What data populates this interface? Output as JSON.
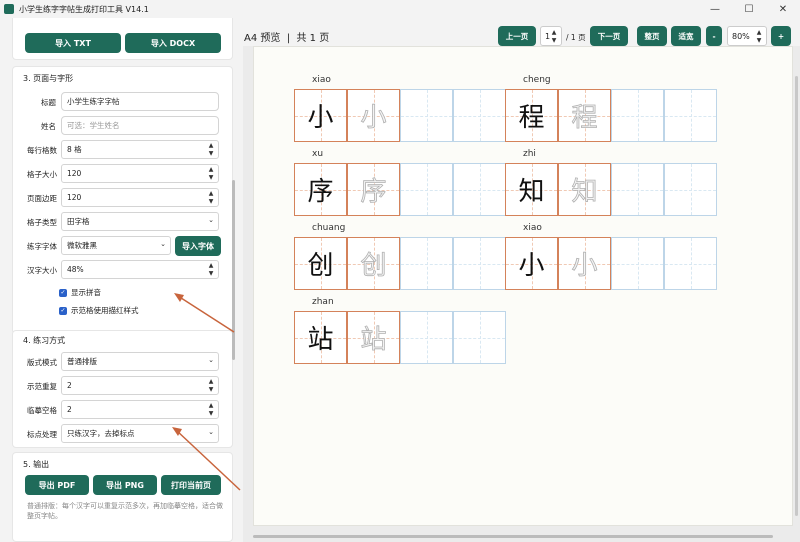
{
  "window": {
    "title": "小学生练字字帖生成打印工具 V14.1",
    "controls": [
      "—",
      "☐",
      "✕"
    ]
  },
  "import": {
    "txt": "导入 TXT",
    "docx": "导入 DOCX"
  },
  "section3": {
    "title": "3. 页面与字形",
    "title_label": "标题",
    "title_value": "小学生练字字帖",
    "name_label": "姓名",
    "name_placeholder": "可选：学生姓名",
    "per_row_label": "每行格数",
    "per_row_value": "8 格",
    "cell_size_label": "格子大小",
    "cell_size_value": "120",
    "margin_label": "页面边距",
    "margin_value": "120",
    "grid_type_label": "格子类型",
    "grid_type_value": "田字格",
    "font_label": "练字字体",
    "font_value": "微软雅黑",
    "import_font": "导入字体",
    "char_size_label": "汉字大小",
    "char_size_value": "48%",
    "show_pinyin": "显示拼音",
    "trace_style": "示范格使用描红样式"
  },
  "section4": {
    "title": "4. 练习方式",
    "layout_label": "版式模式",
    "layout_value": "普通排版",
    "demo_repeat_label": "示范重复",
    "demo_repeat_value": "2",
    "copy_blank_label": "临摹空格",
    "copy_blank_value": "2",
    "punct_label": "标点处理",
    "punct_value": "只练汉字，去掉标点"
  },
  "section5": {
    "title": "5. 输出",
    "export_pdf": "导出 PDF",
    "export_png": "导出 PNG",
    "print_page": "打印当前页",
    "help": "普通排版：每个汉字可以重复示范多次，再加临摹空格，适合做整页字帖。"
  },
  "preview": {
    "title": "A4 预览",
    "page_count": "共 1 页",
    "prev": "上一页",
    "page_value": "1",
    "page_total": "/ 1 页",
    "next": "下一页",
    "fit_page": "整页",
    "fit_width": "适宽",
    "zoom_out": "-",
    "zoom_value": "80%",
    "zoom_in": "+"
  },
  "practice": [
    {
      "char": "小",
      "pinyin": "xiao"
    },
    {
      "char": "程",
      "pinyin": "cheng"
    },
    {
      "char": "序",
      "pinyin": "xu"
    },
    {
      "char": "知",
      "pinyin": "zhi"
    },
    {
      "char": "创",
      "pinyin": "chuang"
    },
    {
      "char": "小",
      "pinyin": "xiao"
    },
    {
      "char": "站",
      "pinyin": "zhan"
    }
  ],
  "colors": {
    "accent": "#1f6b5a",
    "demo_border": "#d4825a",
    "grid_line": "#bdd5e8",
    "arrow": "#c8643c"
  }
}
